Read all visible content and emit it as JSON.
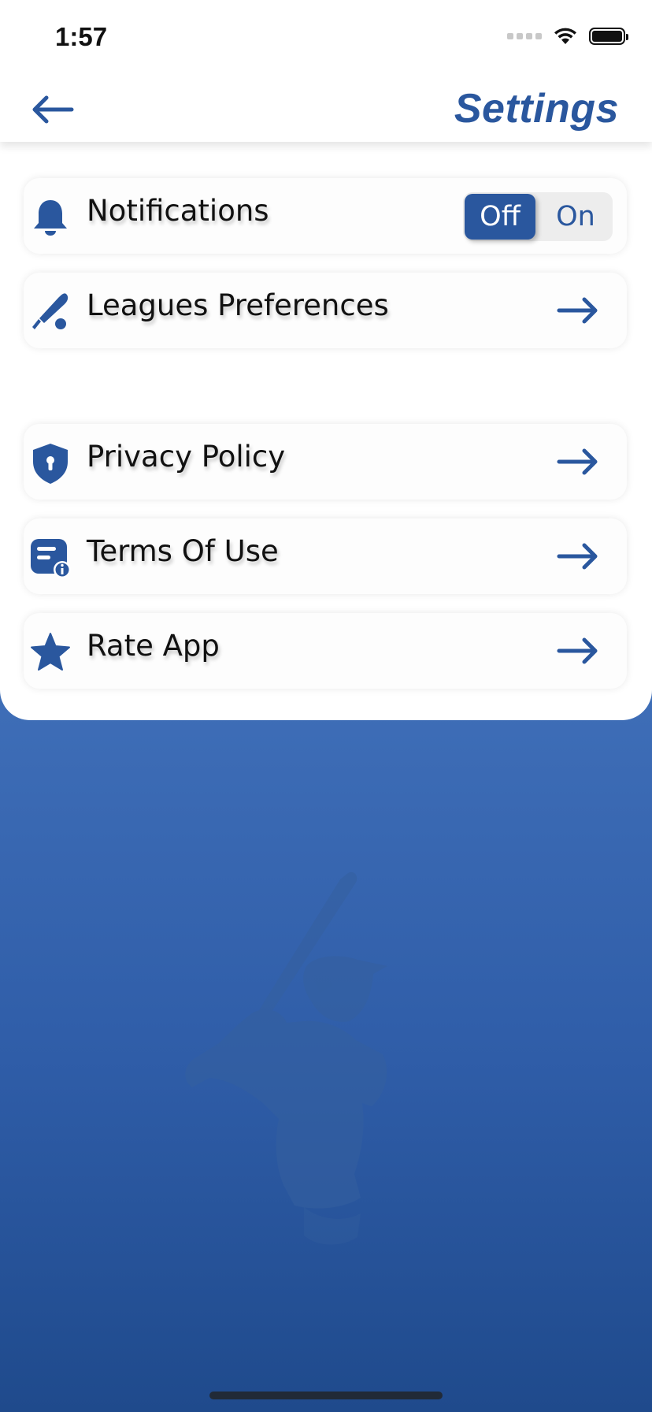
{
  "status_bar": {
    "time": "1:57"
  },
  "header": {
    "title": "Settings",
    "back_icon": "arrow-left-icon"
  },
  "settings": {
    "notifications": {
      "label": "Notifications",
      "icon": "bell-icon",
      "toggle_off": "Off",
      "toggle_on": "On",
      "selected": "Off"
    },
    "leagues": {
      "label": "Leagues Preferences",
      "icon": "baseball-bat-icon"
    },
    "privacy": {
      "label": "Privacy Policy",
      "icon": "shield-icon"
    },
    "terms": {
      "label": "Terms Of Use",
      "icon": "document-info-icon"
    },
    "rate": {
      "label": "Rate App",
      "icon": "star-icon"
    }
  },
  "colors": {
    "accent": "#2a579e",
    "background_top": "#4a7bc4",
    "background_bottom": "#1f4a8c"
  }
}
